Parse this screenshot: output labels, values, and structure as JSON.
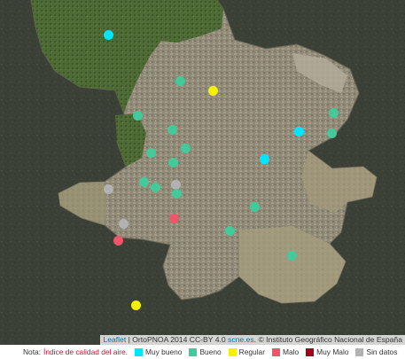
{
  "map": {
    "stations": [
      {
        "level": "muy_bueno",
        "lat": 40.518,
        "lon": -3.774
      },
      {
        "level": "bueno",
        "lat": 40.48,
        "lon": -3.712
      },
      {
        "level": "regular",
        "lat": 40.472,
        "lon": -3.683
      },
      {
        "level": "bueno",
        "lat": 40.452,
        "lon": -3.749
      },
      {
        "level": "bueno",
        "lat": 40.44,
        "lon": -3.719
      },
      {
        "level": "bueno",
        "lat": 40.454,
        "lon": -3.579
      },
      {
        "level": "muy_bueno",
        "lat": 40.439,
        "lon": -3.609
      },
      {
        "level": "bueno",
        "lat": 40.437,
        "lon": -3.58
      },
      {
        "level": "bueno",
        "lat": 40.425,
        "lon": -3.707
      },
      {
        "level": "bueno",
        "lat": 40.421,
        "lon": -3.737
      },
      {
        "level": "muy_bueno",
        "lat": 40.416,
        "lon": -3.639
      },
      {
        "level": "bueno",
        "lat": 40.413,
        "lon": -3.718
      },
      {
        "level": "bueno",
        "lat": 40.397,
        "lon": -3.743
      },
      {
        "level": "bueno",
        "lat": 40.393,
        "lon": -3.733
      },
      {
        "level": "sin_datos",
        "lat": 40.395,
        "lon": -3.716
      },
      {
        "level": "bueno",
        "lat": 40.388,
        "lon": -3.715
      },
      {
        "level": "sin_datos",
        "lat": 40.391,
        "lon": -3.774
      },
      {
        "level": "bueno",
        "lat": 40.377,
        "lon": -3.647
      },
      {
        "level": "malo",
        "lat": 40.367,
        "lon": -3.717
      },
      {
        "level": "sin_datos",
        "lat": 40.363,
        "lon": -3.761
      },
      {
        "level": "bueno",
        "lat": 40.357,
        "lon": -3.669
      },
      {
        "level": "malo",
        "lat": 40.349,
        "lon": -3.766
      },
      {
        "level": "bueno",
        "lat": 40.337,
        "lon": -3.615
      },
      {
        "level": "regular",
        "lat": 40.296,
        "lon": -3.75
      }
    ],
    "levels": {
      "muy_bueno": "#00e5ff",
      "bueno": "#43c99a",
      "regular": "#f5f200",
      "malo": "#ef5669",
      "muy_malo": "#a0001c",
      "sin_datos": "#b2b2b2"
    }
  },
  "attribution": {
    "leaflet": "Leaflet",
    "sep": " | ",
    "source": "OrtoPNOA 2014 CC-BY 4.0 ",
    "domain": "scne.es",
    "rest": ". © Instituto Geográfico Nacional de España"
  },
  "legend": {
    "note": "Nota:",
    "aqi_link": "Índice de calidad del aire.",
    "items": [
      {
        "label": "Muy bueno",
        "color": "#00e5ff"
      },
      {
        "label": "Bueno",
        "color": "#43c99a"
      },
      {
        "label": "Regular",
        "color": "#f5f200"
      },
      {
        "label": "Malo",
        "color": "#ef5669"
      },
      {
        "label": "Muy Malo",
        "color": "#a0001c"
      },
      {
        "label": "Sin datos",
        "color": "#b2b2b2"
      }
    ]
  }
}
